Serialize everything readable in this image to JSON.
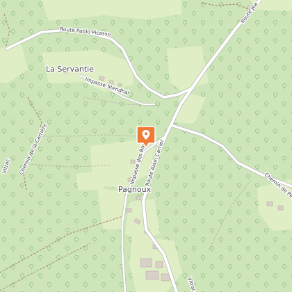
{
  "map": {
    "places": {
      "la_servantie": "La Servantie",
      "pagnoux": "Pagnoux"
    },
    "roads": {
      "route_pablo_picasso": "Route Pablo Picasso",
      "impasse_stendhal": "Impasse Stendhal",
      "route_alain_carrier": "Route Alain Carrier",
      "impasse_des_bouygues": "Impasse des Bouygues",
      "chemin_de_la_carriere": "Chemin de la Carrière",
      "chemin_de_pecher": "Chemin de Pécher",
      "route_jean_top": "Route Jea",
      "vitrac_right": "Vitrac",
      "vitrac_left": "Vitrac"
    },
    "marker": {
      "icon": "location-pin-icon",
      "color": "#f07a35"
    },
    "colors": {
      "forest": "#cde5b9",
      "clearing": "#e0eec6",
      "road": "#ffffff",
      "buildings": "#d9d0c9"
    }
  }
}
